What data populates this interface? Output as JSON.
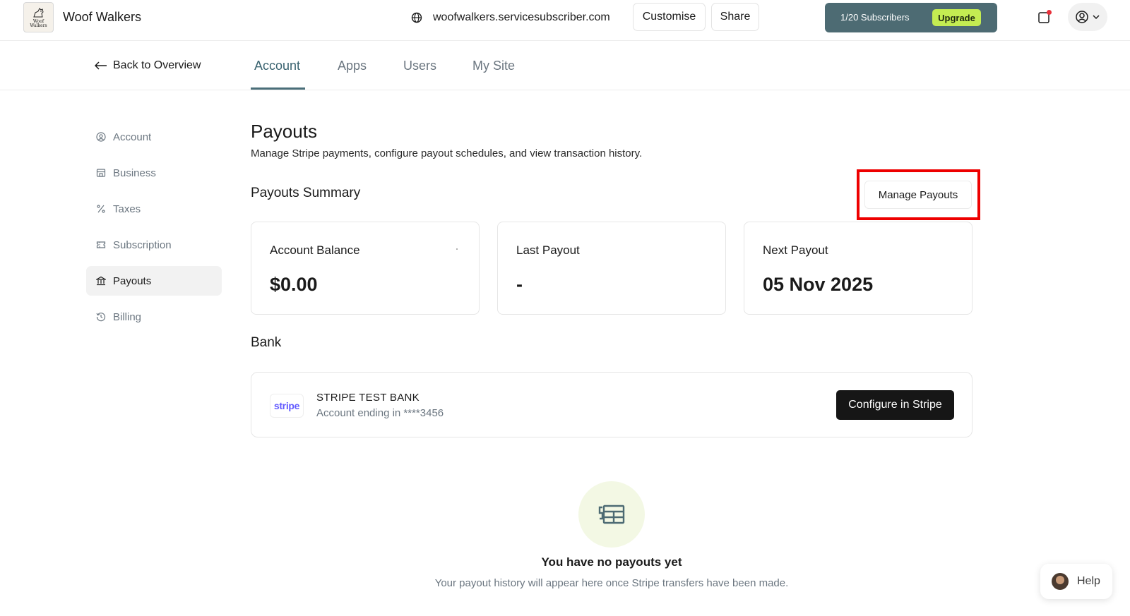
{
  "header": {
    "brand": "Woof Walkers",
    "logo_text": "Woof Walkers",
    "domain": "woofwalkers.servicesubscriber.com",
    "customise_label": "Customise",
    "share_label": "Share",
    "subscribers_label": "1/20 Subscribers",
    "upgrade_label": "Upgrade",
    "colors": {
      "subscribers_bg": "#4d6b73",
      "upgrade_bg": "#c4ec52",
      "notification_dot": "#e8303a"
    }
  },
  "subnav": {
    "back_label": "Back to Overview",
    "tabs": [
      {
        "label": "Account",
        "active": true
      },
      {
        "label": "Apps",
        "active": false
      },
      {
        "label": "Users",
        "active": false
      },
      {
        "label": "My Site",
        "active": false
      }
    ]
  },
  "sidebar": {
    "items": [
      {
        "label": "Account",
        "icon": "user-circle-icon",
        "active": false
      },
      {
        "label": "Business",
        "icon": "store-icon",
        "active": false
      },
      {
        "label": "Taxes",
        "icon": "percent-icon",
        "active": false
      },
      {
        "label": "Subscription",
        "icon": "ticket-icon",
        "active": false
      },
      {
        "label": "Payouts",
        "icon": "bank-icon",
        "active": true
      },
      {
        "label": "Billing",
        "icon": "history-icon",
        "active": false
      }
    ]
  },
  "main": {
    "title": "Payouts",
    "description": "Manage Stripe payments, configure payout schedules, and view transaction history.",
    "summary_title": "Payouts Summary",
    "manage_payouts_label": "Manage Payouts",
    "cards": [
      {
        "label": "Account Balance",
        "value": "$0.00"
      },
      {
        "label": "Last Payout",
        "value": "-"
      },
      {
        "label": "Next Payout",
        "value": "05 Nov 2025"
      }
    ],
    "bank_title": "Bank",
    "bank": {
      "logo_text": "stripe",
      "name": "STRIPE TEST BANK",
      "account": "Account ending in ****3456",
      "configure_label": "Configure in Stripe"
    },
    "empty": {
      "icon": "payout-receipt-icon",
      "title": "You have no payouts yet",
      "subtitle": "Your payout history will appear here once Stripe transfers have been made."
    }
  },
  "help": {
    "label": "Help"
  }
}
